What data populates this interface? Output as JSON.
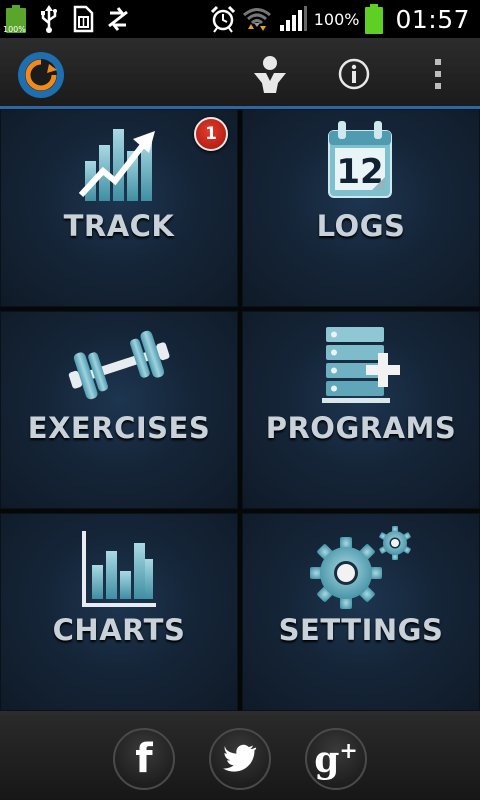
{
  "status_bar": {
    "small_battery_text": "100%",
    "battery_percent": "100%",
    "time": "01:57",
    "icons": [
      "battery-icon",
      "usb-icon",
      "sim-icon",
      "sync-icon",
      "alarm-icon",
      "wifi-icon",
      "signal-icon",
      "battery-icon"
    ]
  },
  "action_bar": {
    "icons": [
      "app-logo-icon",
      "profile-icon",
      "info-icon",
      "overflow-menu-icon"
    ]
  },
  "tiles": [
    {
      "label": "TRACK",
      "icon": "track-chart-arrow-icon",
      "badge": "1"
    },
    {
      "label": "LOGS",
      "icon": "calendar-icon",
      "calendar_day": "12"
    },
    {
      "label": "EXERCISES",
      "icon": "dumbbell-icon"
    },
    {
      "label": "PROGRAMS",
      "icon": "program-list-add-icon"
    },
    {
      "label": "CHARTS",
      "icon": "bar-chart-icon"
    },
    {
      "label": "SETTINGS",
      "icon": "gears-icon"
    }
  ],
  "social": {
    "facebook_glyph": "f",
    "google_glyph": "g",
    "google_plus": "+",
    "icons": [
      "facebook-icon",
      "twitter-icon",
      "google-plus-icon"
    ]
  },
  "colors": {
    "accent": "#2a67a5",
    "tile_bg": "#152538",
    "icon_teal": "#6fb3c4",
    "label": "#c9d2d9",
    "badge": "#c0231a"
  }
}
